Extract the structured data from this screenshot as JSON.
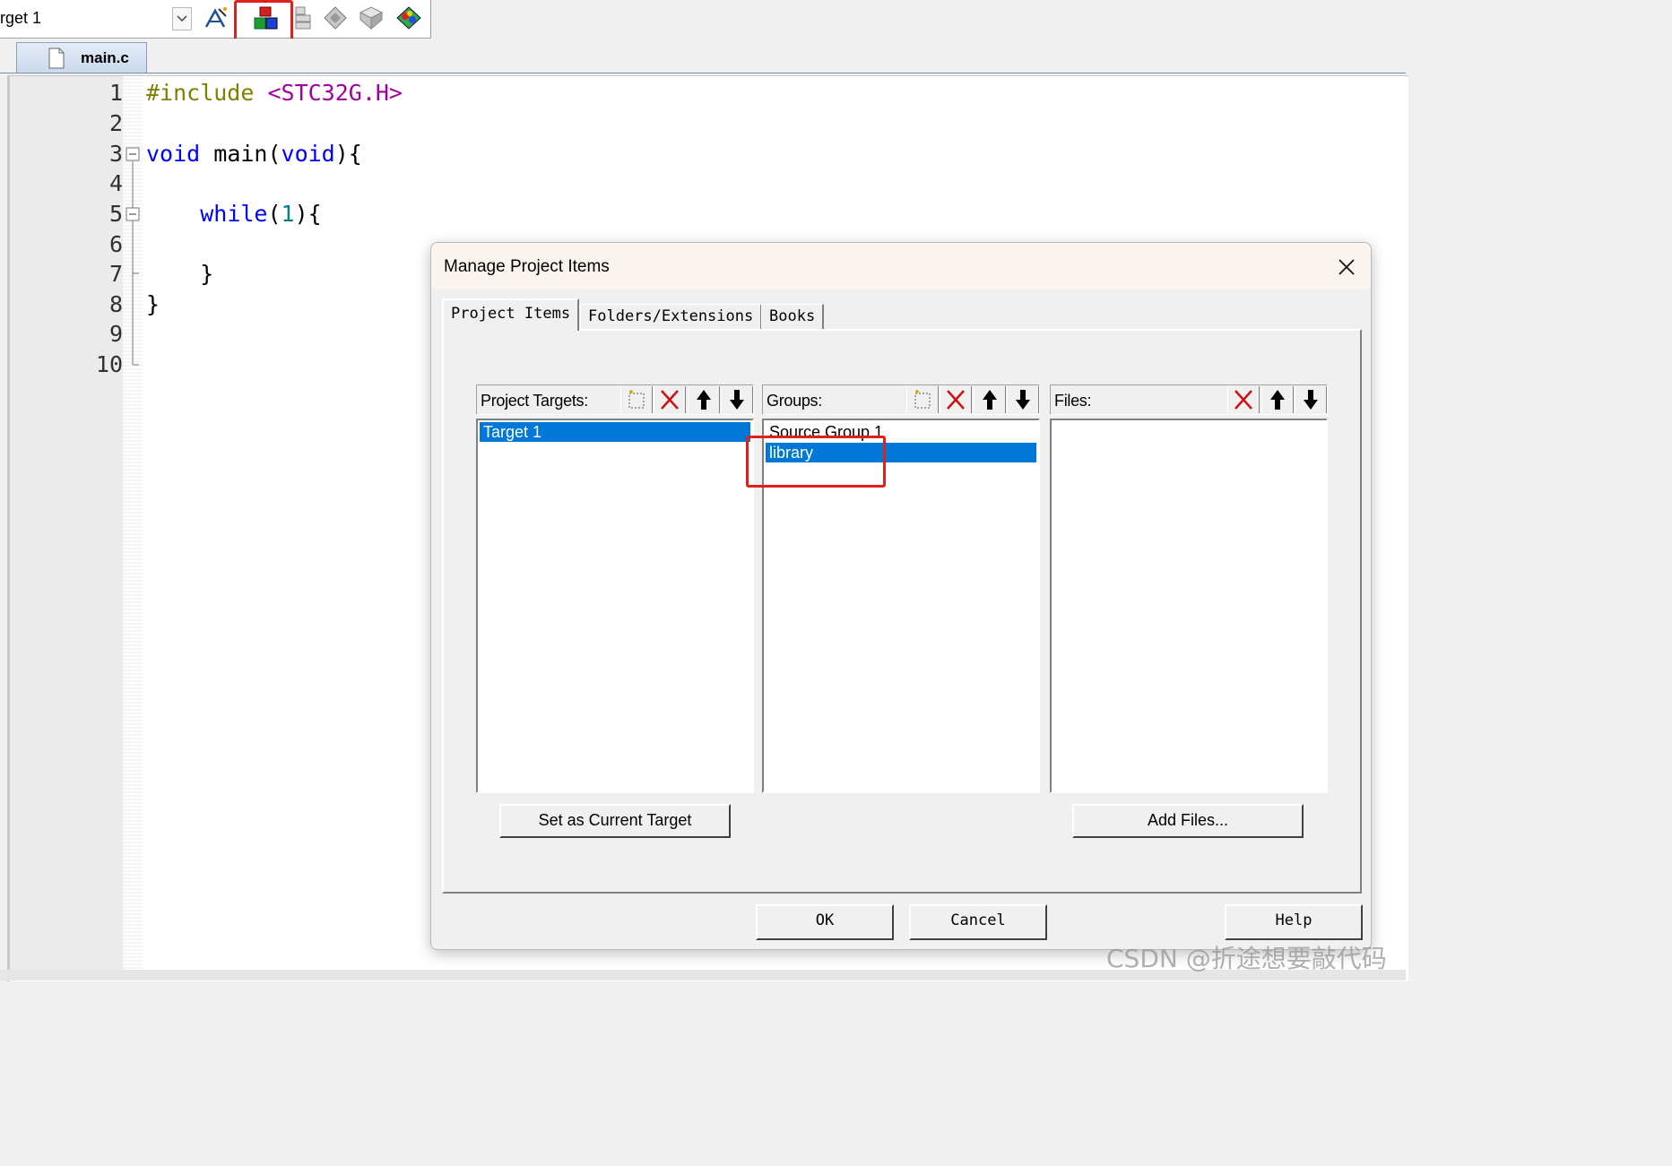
{
  "toolbar": {
    "target_label": "rget 1",
    "icons": [
      "translate-icon",
      "manage-project-items-icon",
      "select-packs-icon",
      "manage-rte-icon",
      "pack-installer-icon",
      "project-map-icon"
    ]
  },
  "editor": {
    "file_tab": "main.c",
    "line_numbers": [
      "1",
      "2",
      "3",
      "4",
      "5",
      "6",
      "7",
      "8",
      "9",
      "10"
    ],
    "lines": {
      "l1_directive": "#include",
      "l1_header": " <STC32G.H>",
      "l3_kw": "void",
      "l3_mid": " main(",
      "l3_kw2": "void",
      "l3_end": "){",
      "l5_indent": "    ",
      "l5_kw": "while",
      "l5_open": "(",
      "l5_num": "1",
      "l5_end": "){",
      "l7": "    }",
      "l8": "}"
    }
  },
  "dialog": {
    "title": "Manage Project Items",
    "tabs": [
      "Project Items",
      "Folders/Extensions",
      "Books"
    ],
    "active_tab": "Project Items",
    "targets": {
      "label": "Project Targets:",
      "items": [
        "Target 1"
      ],
      "selected": "Target 1"
    },
    "groups": {
      "label": "Groups:",
      "items": [
        "Source Group 1",
        "library"
      ],
      "selected": "library"
    },
    "files": {
      "label": "Files:",
      "items": []
    },
    "buttons": {
      "set_current": "Set as Current Target",
      "add_files": "Add Files...",
      "ok": "OK",
      "cancel": "Cancel",
      "help": "Help"
    }
  },
  "watermark": "CSDN @折途想要敲代码",
  "colors": {
    "selection": "#0078d7",
    "highlight_box": "#e0201b",
    "keyword": "#0000ff",
    "preprocessor": "#808000",
    "include_path": "#a000a0",
    "number": "#008080"
  }
}
